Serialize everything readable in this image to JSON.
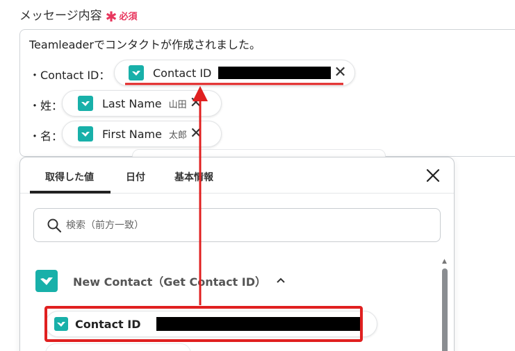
{
  "field": {
    "label": "メッセージ内容",
    "required_mark": "✱",
    "required_text": "必須"
  },
  "editor": {
    "intro": "Teamleaderでコンタクトが作成されました。",
    "lines": [
      {
        "prefix": "・Contact ID：",
        "chip_name": "Contact ID",
        "chip_preview": "",
        "redacted": true
      },
      {
        "prefix": "・姓：",
        "chip_name": "Last Name",
        "chip_preview": "山田",
        "redacted": false
      },
      {
        "prefix": "・名：",
        "chip_name": "First Name",
        "chip_preview": "太郎",
        "redacted": false
      }
    ]
  },
  "panel": {
    "tabs": [
      "取得した値",
      "日付",
      "基本情報"
    ],
    "active_tab": 0,
    "search_placeholder": "検索（前方一致）",
    "group_title": "New Contact（Get Contact ID）",
    "result_item": "Contact ID"
  },
  "colors": {
    "accent_red": "#e02020",
    "app_teal": "#18b0a9",
    "required_pink": "#e8365d"
  },
  "icons": {
    "app": "teamleader-app-icon",
    "close": "close-icon",
    "search": "search-icon",
    "chevron": "chevron-up-icon"
  }
}
